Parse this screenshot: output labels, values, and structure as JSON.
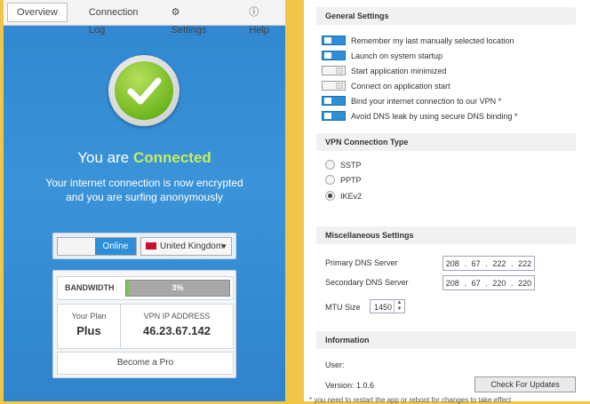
{
  "nav": {
    "overview": "Overview",
    "connection_log": "Connection Log",
    "settings": "Settings",
    "help": "Help"
  },
  "status": {
    "prefix": "You are",
    "state": "Connected",
    "description": "Your internet connection is now encrypted and you are surfing anonymously"
  },
  "connection": {
    "toggle_label": "Online",
    "country": "United Kingdom"
  },
  "bandwidth": {
    "label": "BANDWIDTH",
    "percent_text": "3%",
    "fill_fraction": 0.03
  },
  "plan": {
    "label": "Your Plan",
    "value": "Plus"
  },
  "vpn_ip": {
    "label": "VPN IP ADDRESS",
    "value": "46.23.67.142"
  },
  "become_pro": "Become a Pro",
  "general": {
    "title": "General Settings",
    "items": [
      {
        "label": "Remember my last manually selected location",
        "on": true
      },
      {
        "label": "Launch on system startup",
        "on": true
      },
      {
        "label": "Start application minimized",
        "on": false
      },
      {
        "label": "Connect on application start",
        "on": false
      },
      {
        "label": "Bind your internet connection to our VPN *",
        "on": true
      },
      {
        "label": "Avoid DNS leak by using secure DNS binding *",
        "on": true
      }
    ]
  },
  "vpn_type": {
    "title": "VPN Connection Type",
    "options": [
      {
        "label": "SSTP",
        "selected": false
      },
      {
        "label": "PPTP",
        "selected": false
      },
      {
        "label": "IKEv2",
        "selected": true
      }
    ]
  },
  "misc": {
    "title": "Miscellaneous Settings",
    "primary_label": "Primary DNS Server",
    "primary": [
      "208",
      ".",
      "67",
      ".",
      "222",
      ".",
      "222"
    ],
    "secondary_label": "Secondary DNS Server",
    "secondary": [
      "208",
      ".",
      "67",
      ".",
      "220",
      ".",
      "220"
    ],
    "mtu_label": "MTU Size",
    "mtu_value": "1450"
  },
  "info": {
    "title": "Information",
    "user_label": "User:",
    "version": "Version: 1.0.6",
    "check_updates": "Check For Updates",
    "footnote": "* you need to restart the app or reboot for changes to take effect"
  },
  "colors": {
    "accent_blue": "#2c8ed6",
    "connected_green": "#c5ee5c",
    "frame_yellow": "#f0c64a"
  },
  "icons": {
    "settings": "gear-icon",
    "help": "info-circle-icon",
    "status": "checkmark-icon",
    "flag": "uk-flag-icon"
  }
}
